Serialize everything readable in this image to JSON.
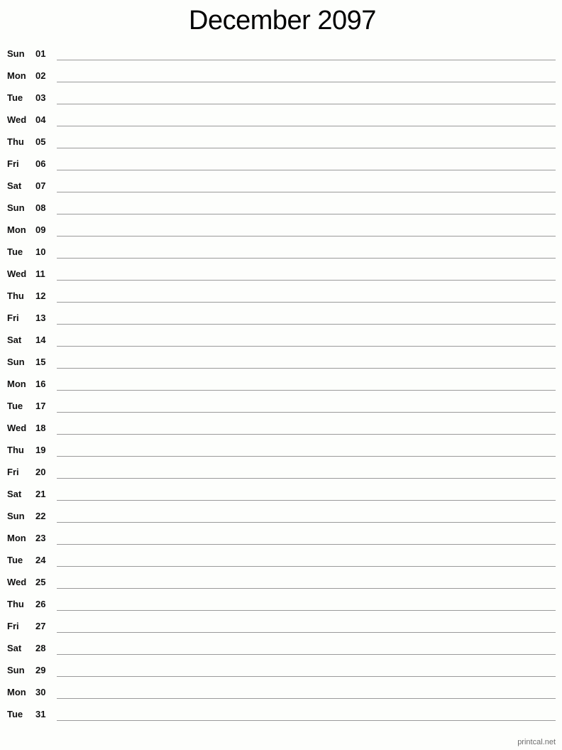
{
  "title": "December 2097",
  "days": [
    {
      "dow": "Sun",
      "date": "01"
    },
    {
      "dow": "Mon",
      "date": "02"
    },
    {
      "dow": "Tue",
      "date": "03"
    },
    {
      "dow": "Wed",
      "date": "04"
    },
    {
      "dow": "Thu",
      "date": "05"
    },
    {
      "dow": "Fri",
      "date": "06"
    },
    {
      "dow": "Sat",
      "date": "07"
    },
    {
      "dow": "Sun",
      "date": "08"
    },
    {
      "dow": "Mon",
      "date": "09"
    },
    {
      "dow": "Tue",
      "date": "10"
    },
    {
      "dow": "Wed",
      "date": "11"
    },
    {
      "dow": "Thu",
      "date": "12"
    },
    {
      "dow": "Fri",
      "date": "13"
    },
    {
      "dow": "Sat",
      "date": "14"
    },
    {
      "dow": "Sun",
      "date": "15"
    },
    {
      "dow": "Mon",
      "date": "16"
    },
    {
      "dow": "Tue",
      "date": "17"
    },
    {
      "dow": "Wed",
      "date": "18"
    },
    {
      "dow": "Thu",
      "date": "19"
    },
    {
      "dow": "Fri",
      "date": "20"
    },
    {
      "dow": "Sat",
      "date": "21"
    },
    {
      "dow": "Sun",
      "date": "22"
    },
    {
      "dow": "Mon",
      "date": "23"
    },
    {
      "dow": "Tue",
      "date": "24"
    },
    {
      "dow": "Wed",
      "date": "25"
    },
    {
      "dow": "Thu",
      "date": "26"
    },
    {
      "dow": "Fri",
      "date": "27"
    },
    {
      "dow": "Sat",
      "date": "28"
    },
    {
      "dow": "Sun",
      "date": "29"
    },
    {
      "dow": "Mon",
      "date": "30"
    },
    {
      "dow": "Tue",
      "date": "31"
    }
  ],
  "footer": {
    "credit": "printcal.net"
  }
}
